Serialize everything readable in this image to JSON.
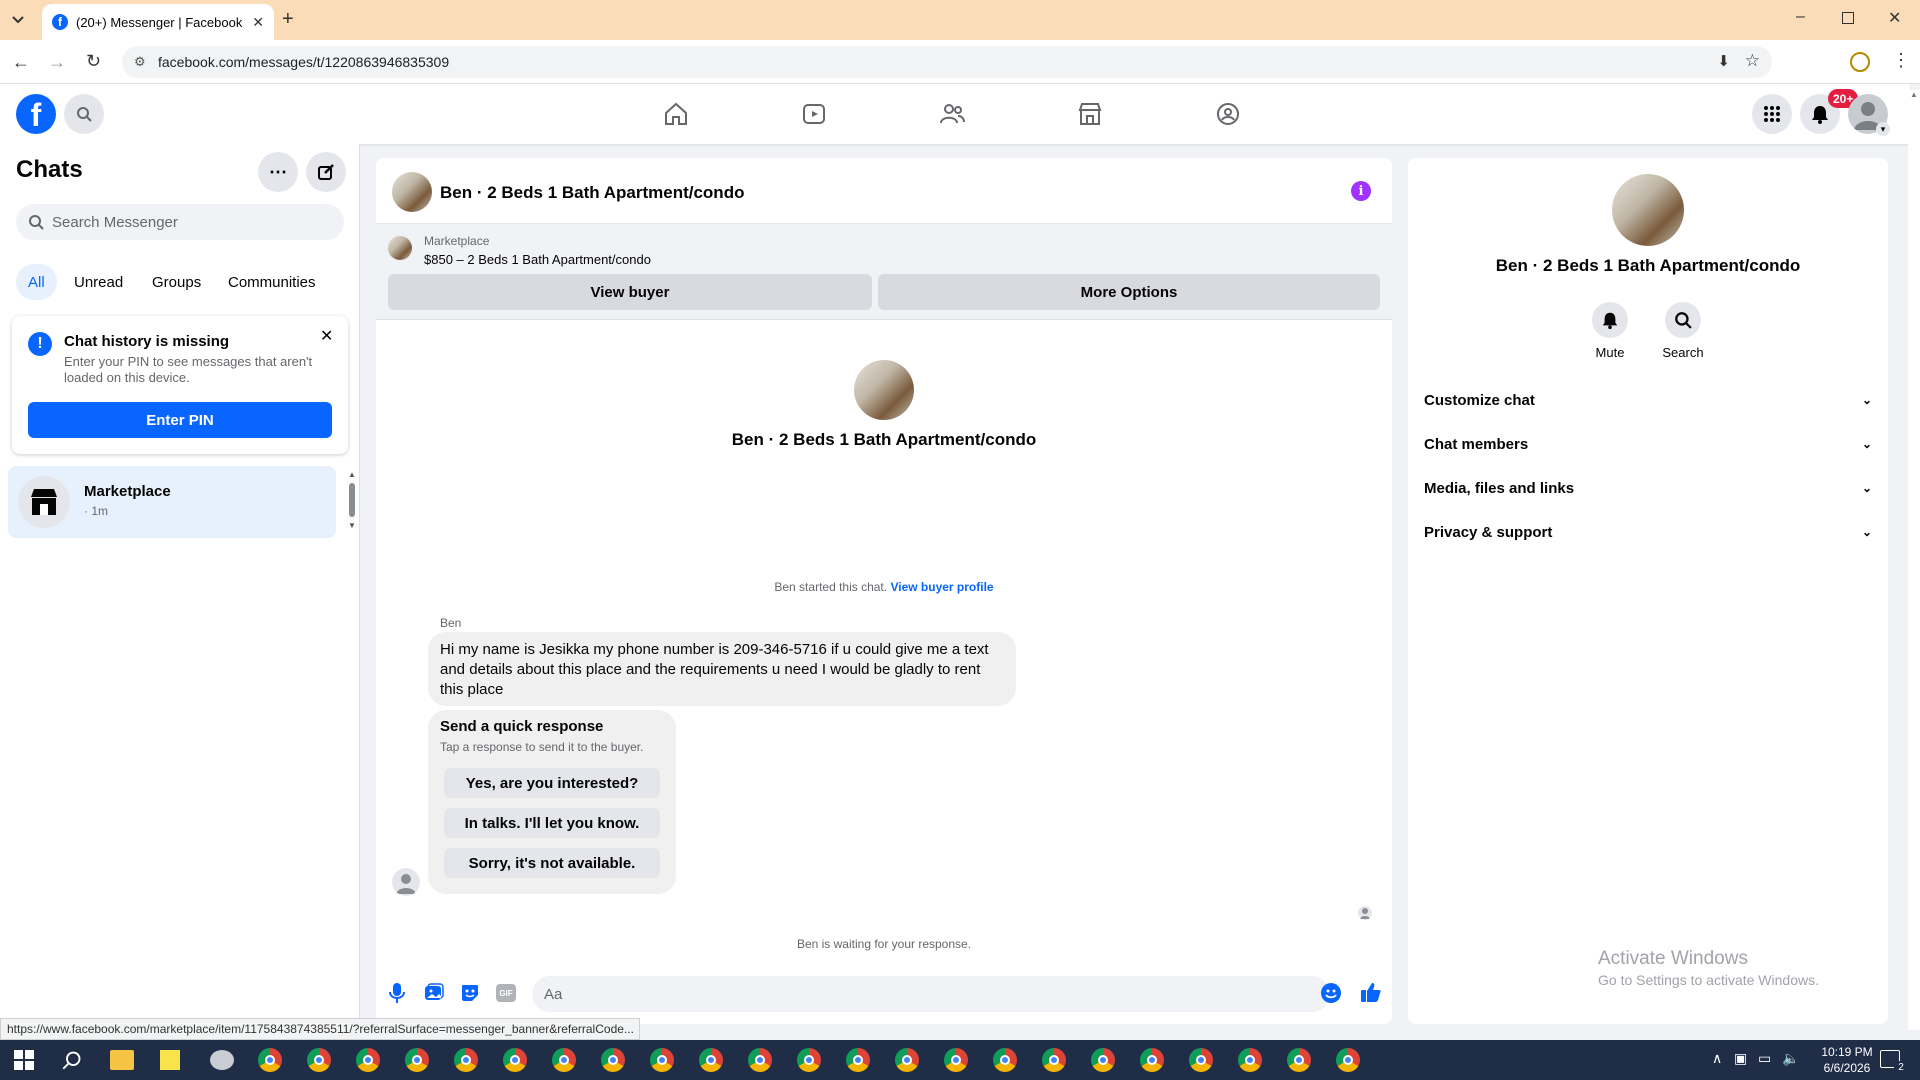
{
  "browser": {
    "tab_title": "(20+) Messenger | Facebook",
    "url": "facebook.com/messages/t/1220863946835309",
    "status_url": "https://www.facebook.com/marketplace/item/1175843874385511/?referralSurface=messenger_banner&referralCode..."
  },
  "header": {
    "notification_badge": "20+"
  },
  "sidebar": {
    "title": "Chats",
    "search_placeholder": "Search Messenger",
    "filters": [
      "All",
      "Unread",
      "Groups",
      "Communities"
    ],
    "history_card": {
      "title": "Chat history is missing",
      "body": "Enter your PIN to see messages that aren't loaded on this device.",
      "button": "Enter PIN"
    },
    "chat_item": {
      "name": "Marketplace",
      "time": "· 1m"
    }
  },
  "conversation": {
    "title": "Ben · 2 Beds 1 Bath Apartment/condo",
    "banner": {
      "label": "Marketplace",
      "listing": "$850 – 2 Beds 1 Bath Apartment/condo",
      "view_buyer": "View buyer",
      "more_options": "More Options"
    },
    "intro_name": "Ben · 2 Beds 1 Bath Apartment/condo",
    "started_text": "Ben started this chat.",
    "view_profile": "View buyer profile",
    "sender": "Ben",
    "message": "Hi my name is Jesikka my phone number is 209-346-5716 if u could give me a text and details about this place and the requirements u need I would be gladly to rent this place",
    "quick": {
      "title": "Send a quick response",
      "subtitle": "Tap a response to send it to the buyer.",
      "options": [
        "Yes, are you interested?",
        "In talks. I'll let you know.",
        "Sorry, it's not available."
      ]
    },
    "waiting": "Ben is waiting for your response.",
    "composer_placeholder": "Aa"
  },
  "right_panel": {
    "name": "Ben · 2 Beds 1 Bath Apartment/condo",
    "mute": "Mute",
    "search": "Search",
    "sections": [
      "Customize chat",
      "Chat members",
      "Media, files and links",
      "Privacy & support"
    ]
  },
  "watermark": {
    "line1": "Activate Windows",
    "line2": "Go to Settings to activate Windows."
  },
  "taskbar": {
    "time": "10:19 PM",
    "date": "6/6/2026",
    "notif_count": "2"
  },
  "colors": {
    "fb_blue": "#0866ff",
    "tab_strip": "#fbdcb8",
    "badge_red": "#e41e3f",
    "info_purple": "#a033ff"
  }
}
